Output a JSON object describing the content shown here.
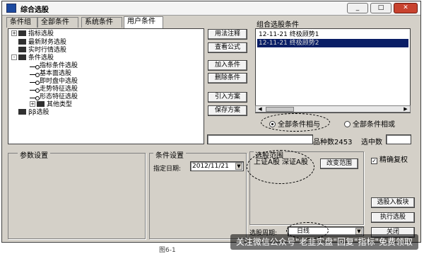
{
  "window": {
    "title": "综合选股",
    "controls": [
      "_",
      "□",
      "✕"
    ]
  },
  "tabs": [
    {
      "label": "条件组",
      "active": false
    },
    {
      "label": "全部条件",
      "active": false
    },
    {
      "label": "系统条件",
      "active": false
    },
    {
      "label": "用户条件",
      "active": true
    }
  ],
  "tree": [
    {
      "label": "指标选股",
      "level": 0,
      "kind": "folder",
      "expander": "+"
    },
    {
      "label": "最新财务选股",
      "level": 0,
      "kind": "folder",
      "expander": ""
    },
    {
      "label": "实时行情选股",
      "level": 0,
      "kind": "folder",
      "expander": ""
    },
    {
      "label": "条件选股",
      "level": 0,
      "kind": "folder",
      "expander": "-"
    },
    {
      "label": "指标条件选股",
      "level": 1,
      "kind": "leaf",
      "expander": ""
    },
    {
      "label": "基本面选股",
      "level": 1,
      "kind": "leaf",
      "expander": ""
    },
    {
      "label": "即时盘中选股",
      "level": 1,
      "kind": "leaf",
      "expander": ""
    },
    {
      "label": "走势特征选股",
      "level": 1,
      "kind": "leaf",
      "expander": ""
    },
    {
      "label": "形态特征选股",
      "level": 1,
      "kind": "leaf",
      "expander": ""
    },
    {
      "label": "其他类型",
      "level": 1,
      "kind": "folder",
      "expander": "+"
    },
    {
      "label": "ββ选股",
      "level": 0,
      "kind": "folder",
      "expander": ""
    }
  ],
  "actions": {
    "usage_note": "用法注释",
    "view_formula": "查看公式",
    "add_condition": "加入条件",
    "delete_condition": "删除条件",
    "load_plan": "引入方案",
    "save_plan": "保存方案"
  },
  "conditions": {
    "label": "组合选股条件",
    "items": [
      {
        "text": "12-11-21  终极顾势1",
        "selected": false
      },
      {
        "text": "12-11-21  终极顾势2",
        "selected": true
      }
    ]
  },
  "logic": {
    "all_and": "全部条件相与",
    "all_or": "全部条件相或",
    "selected": "and"
  },
  "stats": {
    "variety_label": "品种数",
    "variety_value": "2453",
    "hit_label": "选中数",
    "hit_value": ""
  },
  "params": {
    "label": "参数设置"
  },
  "cond_settings": {
    "label": "条件设置",
    "date_label": "指定日期:",
    "date_value": "2012/11/21"
  },
  "range": {
    "label": "选股范围",
    "value": "上证A股 深证A股",
    "change_button": "改变范围"
  },
  "options": {
    "precise_reweight": "精确复权",
    "precise_checked": true
  },
  "bottom": {
    "cycle_label": "选股周期:",
    "cycle_value": "日线",
    "to_board": "选股入板块",
    "run": "执行选股",
    "close": "关闭"
  },
  "caption": {
    "figure": "图6-1"
  },
  "watermark": {
    "text": "关注微信公众号\"老韭实盘\"回复\"指标\"免费领取"
  }
}
